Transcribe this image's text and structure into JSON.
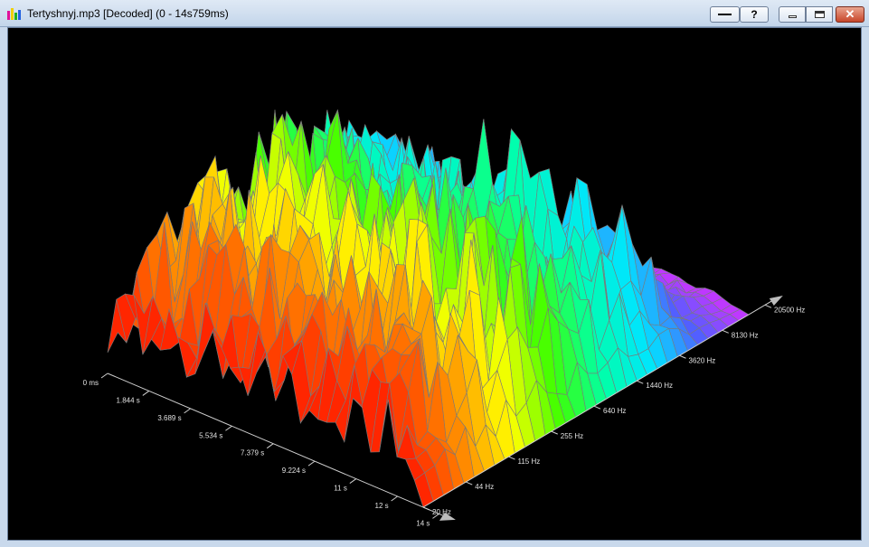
{
  "window": {
    "title": "Tertyshnyj.mp3 [Decoded] (0 - 14s759ms)",
    "help_label": "?",
    "close_label": "✕",
    "icons": [
      "app-spectrum-icon",
      "line-icon",
      "minimize-icon",
      "maximize-icon",
      "close-icon"
    ],
    "colors": {
      "background": "#000000",
      "axis": "#cfcfcf",
      "grid_line": "#7a7a7a"
    }
  },
  "chart_data": {
    "type": "3d-spectrogram",
    "time_axis": {
      "tick_labels": [
        "0 ms",
        "1.844 s",
        "3.689 s",
        "5.534 s",
        "7.379 s",
        "9.224 s",
        "11 s",
        "12 s",
        "14 s"
      ],
      "range": [
        0,
        14.759
      ]
    },
    "frequency_axis": {
      "tick_labels": [
        "20 Hz",
        "44 Hz",
        "115 Hz",
        "255 Hz",
        "640 Hz",
        "1440 Hz",
        "3620 Hz",
        "8130 Hz",
        "20500 Hz"
      ],
      "scale": "log",
      "range": [
        20,
        20500
      ]
    },
    "color_map": [
      "#ff1a00",
      "#ff8c00",
      "#ffff00",
      "#40ff00",
      "#00ffaa",
      "#00e5ff",
      "#5060ff",
      "#cc33ff"
    ],
    "band_envelope": [
      0.35,
      0.62,
      0.7,
      0.78,
      0.66,
      0.58,
      0.5,
      0.1,
      0.04
    ],
    "peaks": [
      {
        "t": 0.18,
        "f": 0.18,
        "value": 0.55
      },
      {
        "t": 0.25,
        "f": 0.3,
        "value": 0.72
      },
      {
        "t": 0.28,
        "f": 0.43,
        "value": 0.82
      },
      {
        "t": 0.4,
        "f": 0.38,
        "value": 0.62
      },
      {
        "t": 0.55,
        "f": 0.5,
        "value": 0.7
      },
      {
        "t": 0.62,
        "f": 0.56,
        "value": 0.92
      },
      {
        "t": 0.68,
        "f": 0.6,
        "value": 1.0
      },
      {
        "t": 0.72,
        "f": 0.64,
        "value": 0.72
      },
      {
        "t": 0.78,
        "f": 0.7,
        "value": 0.66
      },
      {
        "t": 0.88,
        "f": 0.72,
        "value": 0.6
      }
    ]
  }
}
